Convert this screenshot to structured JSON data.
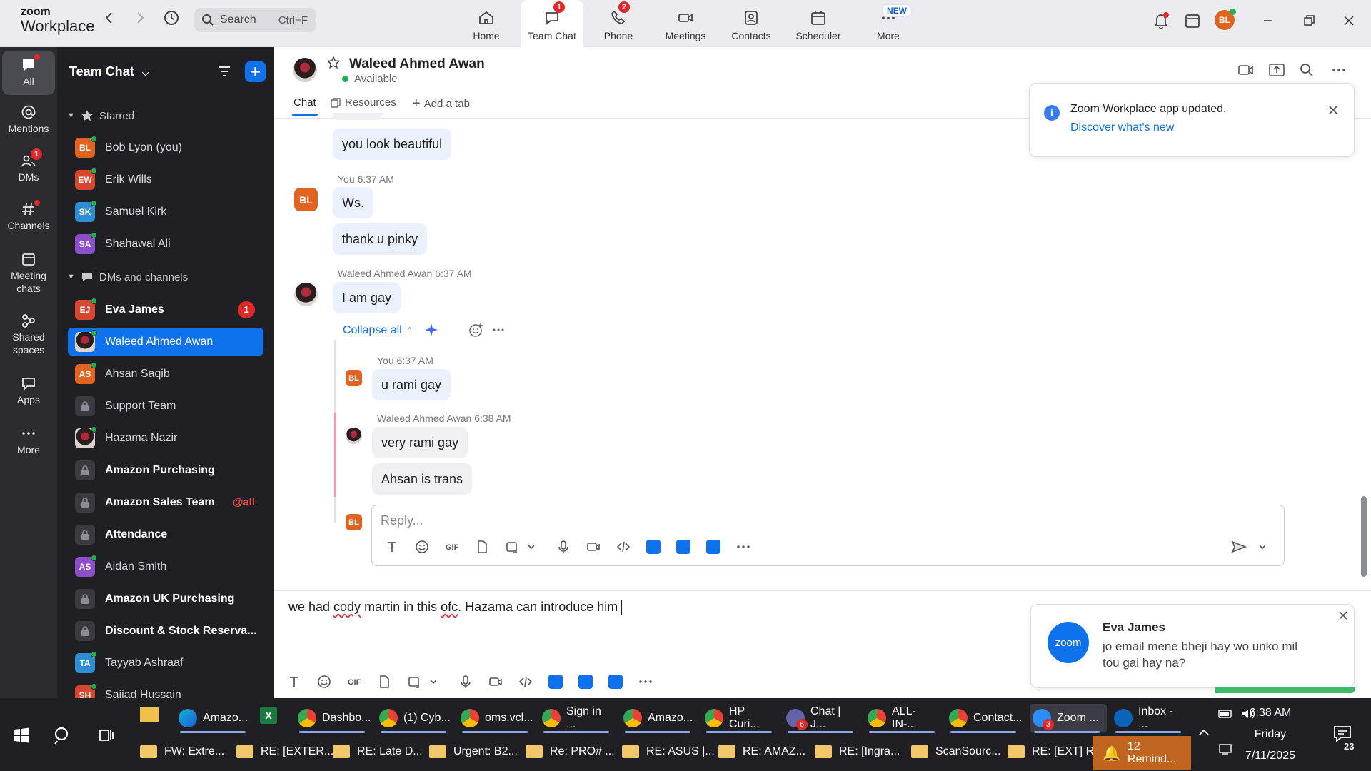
{
  "app": {
    "logo_line1": "zoom",
    "logo_line2": "Workplace"
  },
  "search": {
    "label": "Search",
    "shortcut": "Ctrl+F"
  },
  "top_tabs": [
    {
      "label": "Home",
      "icon": "home-icon"
    },
    {
      "label": "Team Chat",
      "icon": "chat-icon",
      "badge": "1"
    },
    {
      "label": "Phone",
      "icon": "phone-icon",
      "badge": "2"
    },
    {
      "label": "Meetings",
      "icon": "video-icon"
    },
    {
      "label": "Contacts",
      "icon": "contacts-icon"
    },
    {
      "label": "Scheduler",
      "icon": "calendar-icon"
    },
    {
      "label": "More",
      "icon": "more-icon",
      "badge": "NEW"
    }
  ],
  "user_avatar": "BL",
  "rail": [
    {
      "label": "All",
      "icon": "chat-bubble-icon"
    },
    {
      "label": "Mentions",
      "icon": "at-icon"
    },
    {
      "label": "DMs",
      "icon": "people-icon",
      "badge": "1"
    },
    {
      "label": "Channels",
      "icon": "hash-icon"
    },
    {
      "label": "Meeting chats",
      "icon": "calendar-icon"
    },
    {
      "label": "Shared spaces",
      "icon": "share-icon"
    },
    {
      "label": "Apps",
      "icon": "apps-icon"
    },
    {
      "label": "More",
      "icon": "more-icon"
    }
  ],
  "sidebar": {
    "title": "Team Chat",
    "starred_label": "Starred",
    "starred": [
      {
        "initials": "BL",
        "name": "Bob Lyon (you)",
        "color": "#e0641f"
      },
      {
        "initials": "EW",
        "name": "Erik Wills",
        "color": "#d7462f"
      },
      {
        "initials": "SK",
        "name": "Samuel Kirk",
        "color": "#2f8ed1"
      },
      {
        "initials": "SA",
        "name": "Shahawal Ali",
        "color": "#8b4fc9"
      }
    ],
    "dms_label": "DMs and channels",
    "items": [
      {
        "initials": "EJ",
        "name": "Eva James",
        "color": "#d7462f",
        "badge": "1"
      },
      {
        "initials": "",
        "name": "Waleed Ahmed Awan",
        "color": "#3a3a40"
      },
      {
        "initials": "AS",
        "name": "Ahsan Saqib",
        "color": "#e0641f"
      },
      {
        "name": "Support Team"
      },
      {
        "initials": "",
        "name": "Hazama Nazir",
        "color": "#5a3a40"
      },
      {
        "name": "Amazon Purchasing"
      },
      {
        "name": "Amazon Sales Team",
        "mention": "@all"
      },
      {
        "name": "Attendance"
      },
      {
        "initials": "AS",
        "name": "Aidan Smith",
        "color": "#8b4fc9"
      },
      {
        "name": "Amazon UK Purchasing"
      },
      {
        "name": "Discount & Stock Reserva..."
      },
      {
        "initials": "TA",
        "name": "Tayyab Ashraaf",
        "color": "#2f8ed1"
      },
      {
        "initials": "SH",
        "name": "Sajjad Hussain",
        "color": "#d7462f"
      }
    ]
  },
  "chat": {
    "name": "Waleed Ahmed Awan",
    "status": "Available",
    "tabs": [
      "Chat",
      "Resources",
      "Add a tab"
    ],
    "messages": [
      {
        "text": "you look beautiful"
      },
      {
        "meta_name": "You",
        "meta_time": "6:37 AM",
        "avatar": "BL",
        "text": "Ws."
      },
      {
        "text": "thank u pinky"
      },
      {
        "meta_name": "Waleed Ahmed Awan",
        "meta_time": "6:37 AM",
        "text": "I am gay"
      }
    ],
    "collapse_label": "Collapse all",
    "thread": [
      {
        "meta_name": "You",
        "meta_time": "6:37 AM",
        "avatar": "BL",
        "text": "u rami gay"
      },
      {
        "meta_name": "Waleed Ahmed Awan",
        "meta_time": "6:38 AM",
        "text": "very rami gay"
      },
      {
        "text": "Ahsan is trans"
      }
    ],
    "reply_placeholder": "Reply...",
    "reply_avatar": "BL",
    "composer_pre": "we had ",
    "composer_word1": "cody",
    "composer_mid": " martin in this ",
    "composer_word2": "ofc",
    "composer_post": ". Hazama can introduce him"
  },
  "toasts": {
    "update_title": "Zoom Workplace app updated.",
    "update_link": "Discover what's new",
    "notif_logo": "zoom",
    "notif_name": "Eva James",
    "notif_text": "jo email mene bheji hay wo unko mil tou gai hay na?"
  },
  "taskbar": {
    "apps": [
      {
        "label": "Amazo..."
      },
      {
        "label": "Dashbo..."
      },
      {
        "label": "(1) Cyb..."
      },
      {
        "label": "oms.vcl..."
      },
      {
        "label": "Sign in ..."
      },
      {
        "label": "Amazo..."
      },
      {
        "label": "HP Curi..."
      },
      {
        "label": "Chat | J...",
        "badge": "6"
      },
      {
        "label": "ALL-IN-..."
      },
      {
        "label": "Contact..."
      },
      {
        "label": "Zoom ...",
        "badge": "3"
      },
      {
        "label": "Inbox - ..."
      }
    ],
    "mails": [
      "FW: Extre...",
      "RE: [EXTER...",
      "RE: Late D...",
      "Urgent: B2...",
      "Re: PRO# ...",
      "RE: ASUS |...",
      "RE: AMAZ...",
      "RE: [Ingra...",
      "ScanSourc...",
      "RE: [EXT] R..."
    ],
    "reminder": "12 Remind...",
    "time": "6:38 AM",
    "day": "Friday",
    "date": "7/11/2025",
    "notif_count": "23"
  },
  "colors": {
    "accent": "#0e72ed",
    "badge": "#e02828",
    "sidebar_bg": "#1f1f24",
    "rail_bg": "#2b2b30"
  }
}
